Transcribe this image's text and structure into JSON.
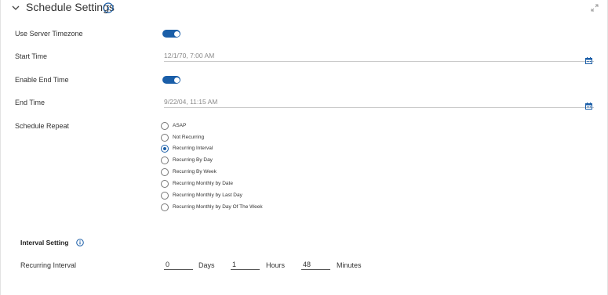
{
  "header": {
    "title": "Schedule Settings",
    "chevron_icon": "chevron-down-icon",
    "info_icon": "info-circle-icon",
    "expand_icon": "expand-arrows-icon"
  },
  "fields": {
    "use_server_timezone": {
      "label": "Use Server Timezone",
      "enabled": true
    },
    "start_time": {
      "label": "Start Time",
      "value": "12/1/70, 7:00 AM",
      "icon": "calendar-icon"
    },
    "enable_end_time": {
      "label": "Enable End Time",
      "enabled": true
    },
    "end_time": {
      "label": "End Time",
      "value": "9/22/04, 11:15 AM",
      "icon": "calendar-icon"
    }
  },
  "schedule_repeat": {
    "label": "Schedule Repeat",
    "selected": "Recurring Interval",
    "options": [
      "ASAP",
      "Not Recurring",
      "Recurring Interval",
      "Recurring By Day",
      "Recurring By Week",
      "Recurring Monthly by Date",
      "Recurring Monthly by Last Day",
      "Recurring Monthly by Day Of The Week"
    ]
  },
  "interval_setting": {
    "title": "Interval Setting",
    "info_icon": "info-circle-icon",
    "label": "Recurring Interval",
    "days": {
      "value": "0",
      "unit": "Days"
    },
    "hours": {
      "value": "1",
      "unit": "Hours"
    },
    "minutes": {
      "value": "48",
      "unit": "Minutes"
    }
  },
  "colors": {
    "accent": "#1a5ea8",
    "text": "#333333",
    "muted_text": "#8a8a8a",
    "field_border": "#c9c9c9"
  }
}
